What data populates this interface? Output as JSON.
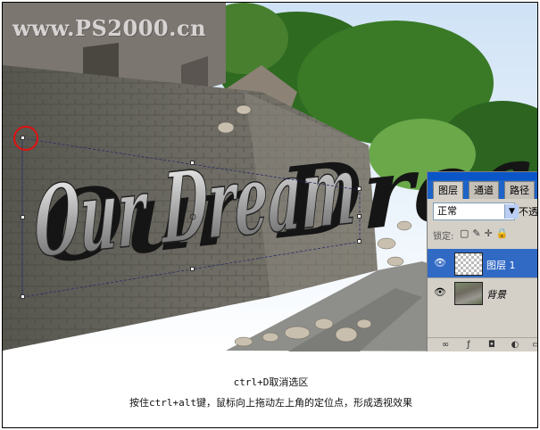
{
  "watermark": "www.PS2000.cn",
  "artwork_text": "Our Dream",
  "layers_panel": {
    "tabs": [
      "图层",
      "通道",
      "路径"
    ],
    "blend_mode": "正常",
    "blend_arrow": "▼",
    "opacity_label": "不透",
    "lock_label": "锁定:",
    "lock_icons": "▢✎✛🔒",
    "layers": [
      {
        "name": "图层 1",
        "selected": true
      },
      {
        "name": "背景",
        "selected": false
      }
    ],
    "bottom_icons": [
      "link-icon",
      "fx-icon",
      "mask-icon",
      "adjustment-icon",
      "folder-icon"
    ]
  },
  "captions": [
    "ctrl+D取消选区",
    "按住ctrl+alt键，鼠标向上拖动左上角的定位点，形成透视效果"
  ],
  "colors": {
    "selected_layer": "#316ac5",
    "panel_bg": "#d4d0c8",
    "marker_circle": "#e01010",
    "tab_strip": "#1e64c8"
  }
}
